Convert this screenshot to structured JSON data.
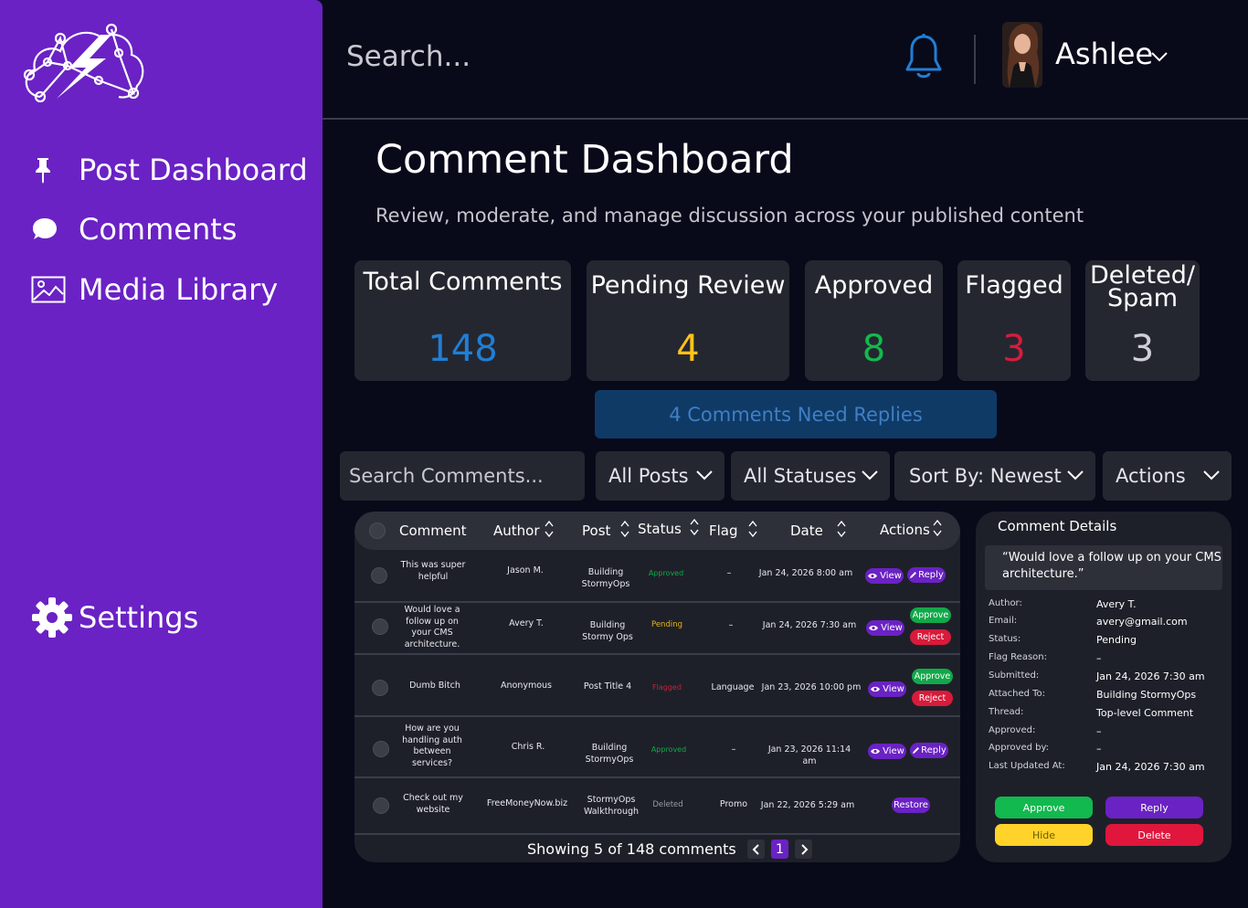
{
  "sidebar": {
    "items": [
      {
        "label": "Post Dashboard",
        "icon": "pin-icon"
      },
      {
        "label": "Comments",
        "icon": "speech-bubble-icon"
      },
      {
        "label": "Media Library",
        "icon": "image-icon"
      }
    ],
    "settings_label": "Settings"
  },
  "topbar": {
    "search_placeholder": "Search...",
    "user_name": "Ashlee"
  },
  "page": {
    "title": "Comment Dashboard",
    "subtitle": "Review, moderate, and manage discussion across your published content"
  },
  "stats": {
    "total": {
      "label": "Total Comments",
      "value": "148",
      "color": "#1f7fd6"
    },
    "pending": {
      "label": "Pending Review",
      "value": "4",
      "color": "#ffc21a"
    },
    "approved": {
      "label": "Approved",
      "value": "8",
      "color": "#12b94e"
    },
    "flagged": {
      "label": "Flagged",
      "value": "3",
      "color": "#d81b3b"
    },
    "deleted": {
      "label_line1": "Deleted/",
      "label_line2": "Spam",
      "value": "3",
      "color": "#cfcfd6"
    }
  },
  "need_replies": "4 Comments Need Replies",
  "filters": {
    "search_placeholder": "Search Comments...",
    "posts": "All Posts",
    "statuses": "All Statuses",
    "sort": "Sort By: Newest",
    "actions": "Actions"
  },
  "table": {
    "headers": {
      "comment": "Comment",
      "author": "Author",
      "post": "Post",
      "status": "Status",
      "flag": "Flag",
      "date": "Date",
      "actions": "Actions"
    },
    "rows": [
      {
        "comment": "This was super helpful",
        "author": "Jason M.",
        "post": "Building StormyOps",
        "status": "Approved",
        "flag": "–",
        "date": "Jan 24, 2026 8:00 am",
        "actions": [
          "View",
          "Reply"
        ]
      },
      {
        "comment": "Would love a follow up on your CMS architecture.",
        "author": "Avery T.",
        "post": "Building Stormy Ops",
        "status": "Pending",
        "flag": "–",
        "date": "Jan 24, 2026 7:30 am",
        "actions": [
          "View",
          "Approve",
          "Reject"
        ]
      },
      {
        "comment": "Dumb Bitch",
        "author": "Anonymous",
        "post": "Post Title 4",
        "status": "Flagged",
        "flag": "Language",
        "date": "Jan 23, 2026 10:00 pm",
        "actions": [
          "View",
          "Approve",
          "Reject"
        ]
      },
      {
        "comment": "How are you handling auth between services?",
        "author": "Chris R.",
        "post": "Building StormyOps",
        "status": "Approved",
        "flag": "–",
        "date": "Jan 23, 2026 11:14 am",
        "actions": [
          "View",
          "Reply"
        ]
      },
      {
        "comment": "Check out my website",
        "author": "FreeMoneyNow.biz",
        "post": "StormyOps Walkthrough",
        "status": "Deleted",
        "flag": "Promo",
        "date": "Jan 22, 2026 5:29 am",
        "actions": [
          "Restore"
        ]
      }
    ],
    "status_colors": {
      "Approved": "#12a84a",
      "Pending": "#e8b512",
      "Flagged": "#c8213b",
      "Deleted": "#9a9ba3"
    },
    "showing": "Showing 5 of 148 comments",
    "page": "1"
  },
  "details": {
    "title": "Comment Details",
    "quote": "“Would love a follow up on your CMS architecture.”",
    "fields": [
      {
        "key": "Author:",
        "value": "Avery T."
      },
      {
        "key": "Email:",
        "value": "avery@gmail.com"
      },
      {
        "key": "Status:",
        "value": "Pending"
      },
      {
        "key": "Flag Reason:",
        "value": "–"
      },
      {
        "key": "Submitted:",
        "value": "Jan 24, 2026 7:30 am"
      },
      {
        "key": "Attached To:",
        "value": "Building StormyOps"
      },
      {
        "key": "Thread:",
        "value": "Top-level Comment"
      },
      {
        "key": "Approved:",
        "value": "–"
      },
      {
        "key": "Approved by:",
        "value": "–"
      },
      {
        "key": "Last Updated At:",
        "value": "Jan 24, 2026 7:30 am"
      }
    ],
    "buttons": {
      "approve": "Approve",
      "reply": "Reply",
      "hide": "Hide",
      "delete": "Delete"
    }
  }
}
